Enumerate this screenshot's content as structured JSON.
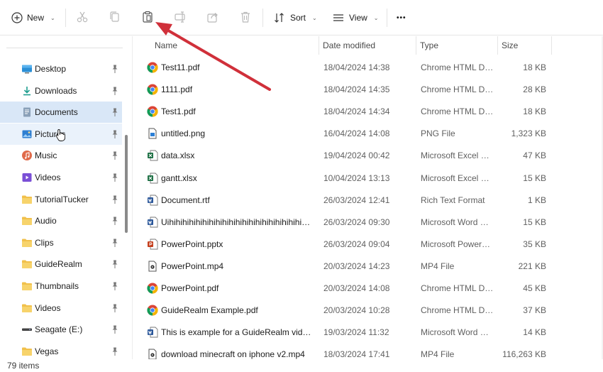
{
  "toolbar": {
    "new_label": "New",
    "sort_label": "Sort",
    "view_label": "View",
    "more_label": "•••",
    "icons": [
      "plus-circle-icon",
      "cut-icon",
      "copy-icon",
      "paste-icon",
      "rename-icon",
      "share-icon",
      "delete-icon",
      "sort-icon",
      "view-icon",
      "more-icon"
    ]
  },
  "sidebar": {
    "items": [
      {
        "label": "Desktop",
        "icon": "desktop-icon",
        "color": "#2b8fd6"
      },
      {
        "label": "Downloads",
        "icon": "download-icon",
        "color": "#1f9e8f"
      },
      {
        "label": "Documents",
        "icon": "documents-icon",
        "color": "#7c8fa6"
      },
      {
        "label": "Pictures",
        "icon": "pictures-icon",
        "color": "#2f7fd1"
      },
      {
        "label": "Music",
        "icon": "music-icon",
        "color": "#e06a4a"
      },
      {
        "label": "Videos",
        "icon": "videos-icon",
        "color": "#7a4fd6"
      },
      {
        "label": "TutorialTucker",
        "icon": "folder-icon",
        "color": "#f1c04b"
      },
      {
        "label": "Audio",
        "icon": "folder-icon",
        "color": "#f1c04b"
      },
      {
        "label": "Clips",
        "icon": "folder-icon",
        "color": "#f1c04b"
      },
      {
        "label": "GuideRealm",
        "icon": "folder-icon",
        "color": "#f1c04b"
      },
      {
        "label": "Thumbnails",
        "icon": "folder-icon",
        "color": "#f1c04b"
      },
      {
        "label": "Videos",
        "icon": "folder-icon",
        "color": "#f1c04b"
      },
      {
        "label": "Seagate (E:)",
        "icon": "drive-icon",
        "color": "#444444"
      },
      {
        "label": "Vegas",
        "icon": "folder-icon",
        "color": "#f1c04b"
      }
    ]
  },
  "list": {
    "columns": {
      "name": "Name",
      "date": "Date modified",
      "type": "Type",
      "size": "Size"
    },
    "rows": [
      {
        "name": "Test11.pdf",
        "date": "18/04/2024 14:38",
        "type": "Chrome HTML Do...",
        "size": "18 KB",
        "icon": "chrome-icon"
      },
      {
        "name": "1111.pdf",
        "date": "18/04/2024 14:35",
        "type": "Chrome HTML Do...",
        "size": "28 KB",
        "icon": "chrome-icon"
      },
      {
        "name": "Test1.pdf",
        "date": "18/04/2024 14:34",
        "type": "Chrome HTML Do...",
        "size": "18 KB",
        "icon": "chrome-icon"
      },
      {
        "name": "untitled.png",
        "date": "16/04/2024 14:08",
        "type": "PNG File",
        "size": "1,323 KB",
        "icon": "image-file-icon"
      },
      {
        "name": "data.xlsx",
        "date": "19/04/2024 00:42",
        "type": "Microsoft Excel W...",
        "size": "47 KB",
        "icon": "excel-icon"
      },
      {
        "name": "gantt.xlsx",
        "date": "10/04/2024 13:13",
        "type": "Microsoft Excel W...",
        "size": "15 KB",
        "icon": "excel-icon"
      },
      {
        "name": "Document.rtf",
        "date": "26/03/2024 12:41",
        "type": "Rich Text Format",
        "size": "1 KB",
        "icon": "word-icon"
      },
      {
        "name": "Uihihihihihihihihihihihihihihihihihihihihihi...",
        "date": "26/03/2024 09:30",
        "type": "Microsoft Word Do...",
        "size": "15 KB",
        "icon": "word-icon"
      },
      {
        "name": "PowerPoint.pptx",
        "date": "26/03/2024 09:04",
        "type": "Microsoft PowerPo...",
        "size": "35 KB",
        "icon": "powerpoint-icon"
      },
      {
        "name": "PowerPoint.mp4",
        "date": "20/03/2024 14:23",
        "type": "MP4 File",
        "size": "221 KB",
        "icon": "video-file-icon"
      },
      {
        "name": "PowerPoint.pdf",
        "date": "20/03/2024 14:08",
        "type": "Chrome HTML Do...",
        "size": "45 KB",
        "icon": "chrome-icon"
      },
      {
        "name": "GuideRealm Example.pdf",
        "date": "20/03/2024 10:28",
        "type": "Chrome HTML Do...",
        "size": "37 KB",
        "icon": "chrome-icon"
      },
      {
        "name": "This is example for a GuideRealm video....",
        "date": "19/03/2024 11:32",
        "type": "Microsoft Word Do...",
        "size": "14 KB",
        "icon": "word-icon"
      },
      {
        "name": "download minecraft on iphone v2.mp4",
        "date": "18/03/2024 17:41",
        "type": "MP4 File",
        "size": "116,263 KB",
        "icon": "video-file-icon"
      }
    ]
  },
  "status": {
    "item_count": "79 items"
  },
  "colors": {
    "arrow": "#d0303a",
    "selected": "#d9e7f7",
    "hover": "#eaf2fb"
  }
}
